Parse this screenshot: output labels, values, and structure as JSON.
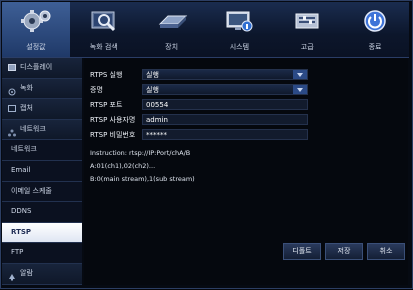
{
  "topbar": {
    "items": [
      {
        "label": "설정값",
        "icon": "gears-icon",
        "active": true
      },
      {
        "label": "녹화 검색",
        "icon": "search-icon",
        "active": false
      },
      {
        "label": "장치",
        "icon": "hdd-icon",
        "active": false
      },
      {
        "label": "시스템",
        "icon": "monitor-info-icon",
        "active": false
      },
      {
        "label": "고급",
        "icon": "advanced-icon",
        "active": false
      },
      {
        "label": "종료",
        "icon": "power-icon",
        "active": false
      }
    ]
  },
  "sidebar": {
    "items": [
      {
        "label": "디스플레이",
        "icon": "display-icon"
      },
      {
        "label": "녹화",
        "icon": "record-icon"
      },
      {
        "label": "캡처",
        "icon": "capture-icon"
      },
      {
        "label": "네트워크",
        "icon": "network-icon"
      },
      {
        "label": "네트워크"
      },
      {
        "label": "Email"
      },
      {
        "label": "이메일 스케줄"
      },
      {
        "label": "DDNS"
      },
      {
        "label": "RTSP",
        "active": true
      },
      {
        "label": "FTP"
      },
      {
        "label": "알람",
        "icon": "alarm-icon"
      }
    ]
  },
  "form": {
    "rtsp_enable_label": "RTPS 실행",
    "rtsp_enable_value": "실행",
    "auth_label": "증명",
    "auth_value": "실행",
    "port_label": "RTSP 포트",
    "port_value": "00554",
    "user_label": "RTSP 사용자명",
    "user_value": "admin",
    "password_label": "RTSP 비밀번호",
    "password_value": "******"
  },
  "instructions": {
    "line1": "Instruction:  rtsp://IP:Port/chA/B",
    "line2": "A:01(ch1),02(ch2)...",
    "line3": "B:0(main stream),1(sub stream)"
  },
  "buttons": {
    "default": "디폴트",
    "save": "저장",
    "cancel": "취소"
  }
}
